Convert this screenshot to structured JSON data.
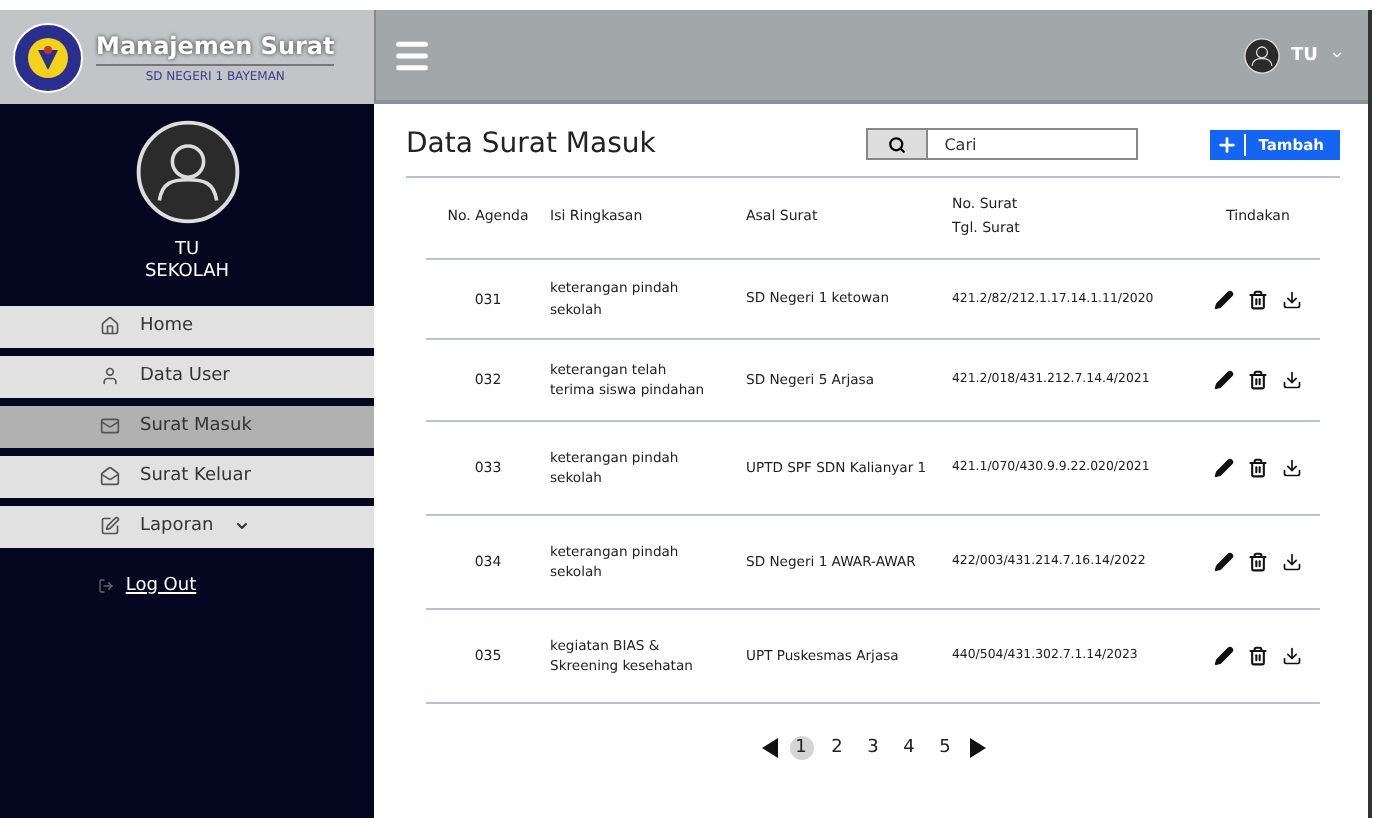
{
  "header": {
    "title": "Manajemen Surat",
    "subtitle": "SD NEGERI 1 BAYEMAN",
    "user_name": "TU"
  },
  "sidebar": {
    "role": [
      "TU",
      "SEKOLAH"
    ],
    "items": [
      {
        "label": "Home",
        "kind": "home",
        "selected": false
      },
      {
        "label": "Data User",
        "kind": "user",
        "selected": false
      },
      {
        "label": "Surat Masuk",
        "kind": "inbox",
        "selected": true
      },
      {
        "label": "Surat Keluar",
        "kind": "outbox",
        "selected": false
      },
      {
        "label": "Laporan",
        "kind": "report",
        "selected": false,
        "dropdown": true
      }
    ],
    "logout": "Log Out"
  },
  "page": {
    "title": "Data Surat Masuk",
    "search": {
      "placeholder": "Cari"
    },
    "add_button": "Tambah"
  },
  "table": {
    "columns": [
      "No. Agenda",
      "Isi Ringkasan",
      "Asal Surat",
      [
        "No. Surat",
        "Tgl. Surat"
      ],
      "Tindakan"
    ],
    "rows": [
      {
        "no": "031",
        "summary": "keterangan pindah sekolah",
        "origin": "SD Negeri 1 ketowan",
        "number": "421.2/82/212.1.17.14.1.11/2020"
      },
      {
        "no": "032",
        "summary": "keterangan telah terima siswa pindahan",
        "origin": "SD Negeri 5 Arjasa",
        "number": "421.2/018/431.212.7.14.4/2021"
      },
      {
        "no": "033",
        "summary": "keterangan pindah sekolah",
        "origin": "UPTD SPF SDN  Kalianyar 1",
        "number": "421.1/070/430.9.9.22.020/2021"
      },
      {
        "no": "034",
        "summary": "keterangan pindah sekolah",
        "origin": "SD Negeri 1 AWAR-AWAR",
        "number": "422/003/431.214.7.16.14/2022"
      },
      {
        "no": "035",
        "summary": "kegiatan BIAS & Skreening kesehatan",
        "origin": "UPT Puskesmas Arjasa",
        "number": "440/504/431.302.7.1.14/2023"
      }
    ]
  },
  "pagination": [
    {
      "label": "1",
      "selected": true
    },
    {
      "label": "2",
      "selected": false
    },
    {
      "label": "3",
      "selected": false
    },
    {
      "label": "4",
      "selected": false
    },
    {
      "label": "5",
      "selected": false
    }
  ]
}
